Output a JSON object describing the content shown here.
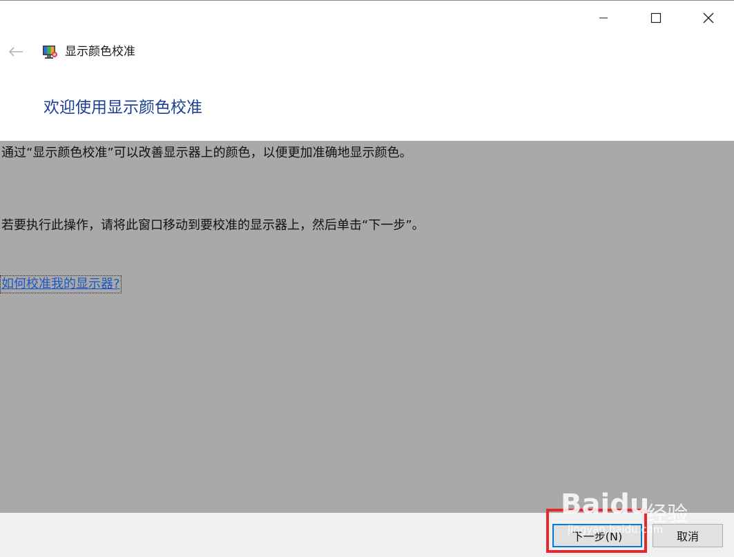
{
  "window": {
    "title": "显示颜色校准"
  },
  "page": {
    "heading": "欢迎使用显示颜色校准",
    "paragraph_1": "通过“显示颜色校准”可以改善显示器上的颜色，以便更加准确地显示颜色。",
    "paragraph_2": "若要执行此操作，请将此窗口移动到要校准的显示器上，然后单击“下一步”。",
    "help_link": "如何校准我的显示器?"
  },
  "footer": {
    "next_label": "下一步(N)",
    "cancel_label": "取消"
  },
  "watermark": {
    "brand": "Baidu",
    "suffix": "经验",
    "url": "jingyan.baidu.com"
  },
  "colors": {
    "heading": "#1c3f94",
    "link": "#1b57c8",
    "content_bg": "#a9a9a9",
    "highlight": "#e8262d"
  },
  "icons": {
    "back": "arrow-left-icon",
    "app": "display-color-calibration-icon",
    "minimize": "minimize-icon",
    "maximize": "maximize-icon",
    "close": "close-icon"
  }
}
